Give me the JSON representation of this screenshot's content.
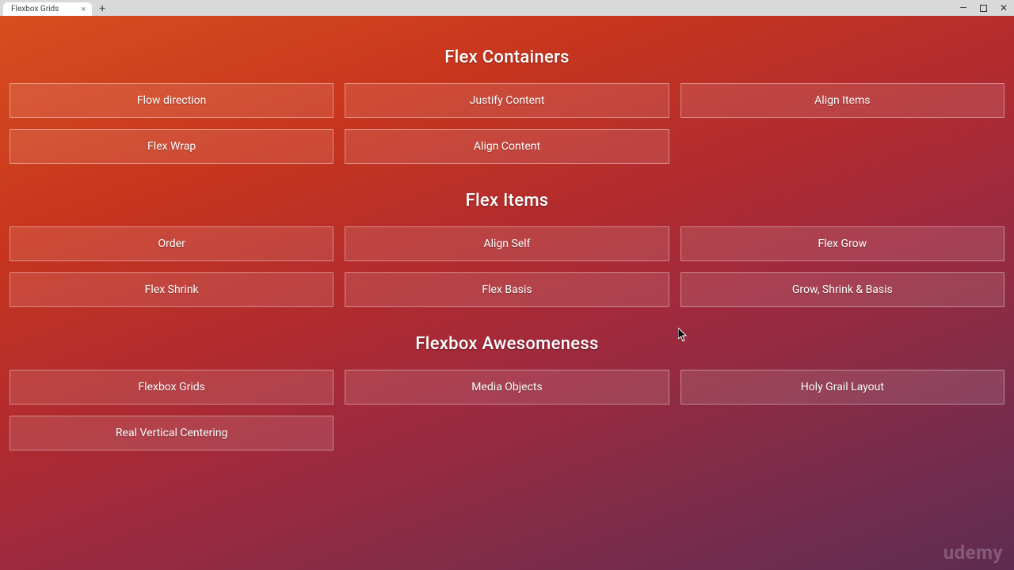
{
  "window": {
    "tab_title": "Flexbox Grids"
  },
  "sections": [
    {
      "title": "Flex Containers",
      "items": [
        {
          "label": "Flow direction",
          "name": "flow-direction"
        },
        {
          "label": "Justify Content",
          "name": "justify-content"
        },
        {
          "label": "Align Items",
          "name": "align-items"
        },
        {
          "label": "Flex Wrap",
          "name": "flex-wrap"
        },
        {
          "label": "Align Content",
          "name": "align-content"
        }
      ]
    },
    {
      "title": "Flex Items",
      "items": [
        {
          "label": "Order",
          "name": "order"
        },
        {
          "label": "Align Self",
          "name": "align-self"
        },
        {
          "label": "Flex Grow",
          "name": "flex-grow"
        },
        {
          "label": "Flex Shrink",
          "name": "flex-shrink"
        },
        {
          "label": "Flex Basis",
          "name": "flex-basis"
        },
        {
          "label": "Grow, Shrink & Basis",
          "name": "grow-shrink-basis"
        }
      ]
    },
    {
      "title": "Flexbox Awesomeness",
      "items": [
        {
          "label": "Flexbox Grids",
          "name": "flexbox-grids"
        },
        {
          "label": "Media Objects",
          "name": "media-objects"
        },
        {
          "label": "Holy Grail Layout",
          "name": "holy-grail-layout"
        },
        {
          "label": "Real Vertical Centering",
          "name": "real-vertical-centering"
        }
      ]
    }
  ],
  "watermark": "udemy"
}
